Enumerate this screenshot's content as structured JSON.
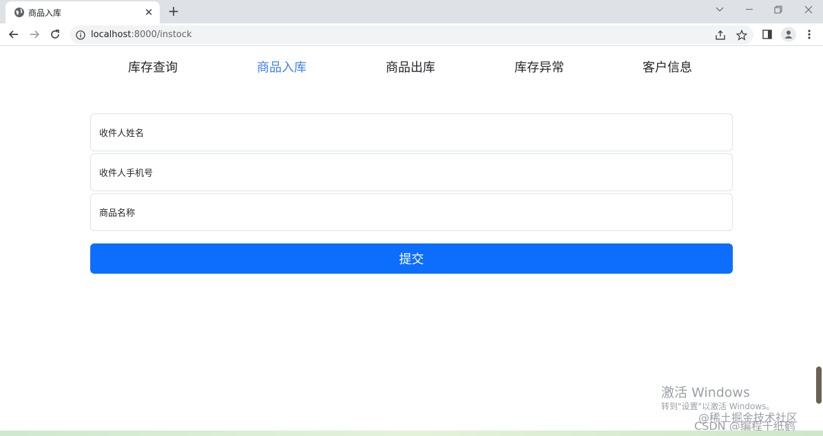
{
  "browser": {
    "tab_title": "商品入库",
    "url_host": "localhost",
    "url_path": ":8000/instock"
  },
  "nav": {
    "items": [
      {
        "label": "库存查询"
      },
      {
        "label": "商品入库"
      },
      {
        "label": "商品出库"
      },
      {
        "label": "库存异常"
      },
      {
        "label": "客户信息"
      }
    ],
    "active_color": "#3b82e8"
  },
  "form": {
    "recipient_name_placeholder": "收件人姓名",
    "recipient_phone_placeholder": "收件人手机号",
    "product_name_placeholder": "商品名称",
    "submit_label": "提交",
    "submit_color": "#0d6efd"
  },
  "watermark": {
    "activate_title": "激活 Windows",
    "activate_hint": "转到\"设置\"以激活 Windows。",
    "community": "@稀土掘金技术社区",
    "csdn": "CSDN @编程千纸鹤"
  }
}
